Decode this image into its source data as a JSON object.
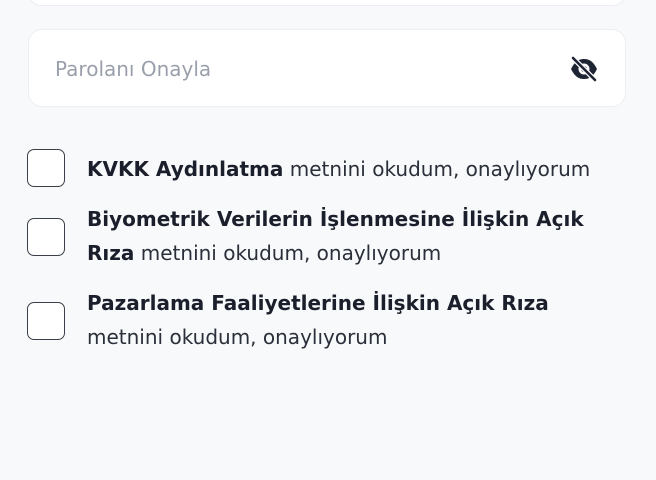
{
  "password_confirm": {
    "placeholder": "Parolanı Onayla",
    "value": "",
    "toggle_icon": "eye-off-icon"
  },
  "consents": [
    {
      "bold": "KVKK Aydınlatma",
      "rest": " metnini okudum, onaylıyorum",
      "checked": false
    },
    {
      "bold": "Biyometrik Verilerin İşlenmesine İlişkin Açık Rıza",
      "rest": " metnini okudum, onaylıyorum",
      "checked": false
    },
    {
      "bold": "Pazarlama Faaliyetlerine İlişkin Açık Rıza",
      "rest": " metnini okudum, onaylıyorum",
      "checked": false
    }
  ],
  "colors": {
    "background": "#f8f9fb",
    "field_background": "#ffffff",
    "text": "#1f2533",
    "placeholder": "#9aa0ab",
    "icon": "#1f2533"
  }
}
